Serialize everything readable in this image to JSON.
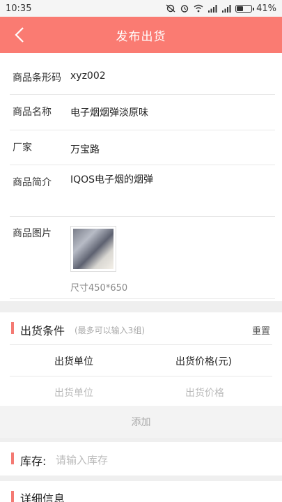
{
  "status": {
    "time": "10:35",
    "battery": "41%"
  },
  "header": {
    "title": "发布出货"
  },
  "form": {
    "barcode": {
      "label": "商品条形码",
      "value": "xyz002"
    },
    "name": {
      "label": "商品名称",
      "value": "电子烟烟弹淡原味"
    },
    "maker": {
      "label": "厂家",
      "value": "万宝路"
    },
    "intro": {
      "label": "商品简介",
      "value": "IQOS电子烟的烟弹"
    },
    "image": {
      "label": "商品图片",
      "size_hint": "尺寸450*650"
    }
  },
  "shipping": {
    "title": "出货条件",
    "hint": "(最多可以输入3组)",
    "reset": "重置",
    "col_unit": "出货单位",
    "col_price": "出货价格(元)",
    "unit_placeholder": "出货单位",
    "price_placeholder": "出货价格",
    "add": "添加"
  },
  "stock": {
    "label": "库存:",
    "placeholder": "请输入库存"
  },
  "details": {
    "title": "详细信息"
  }
}
